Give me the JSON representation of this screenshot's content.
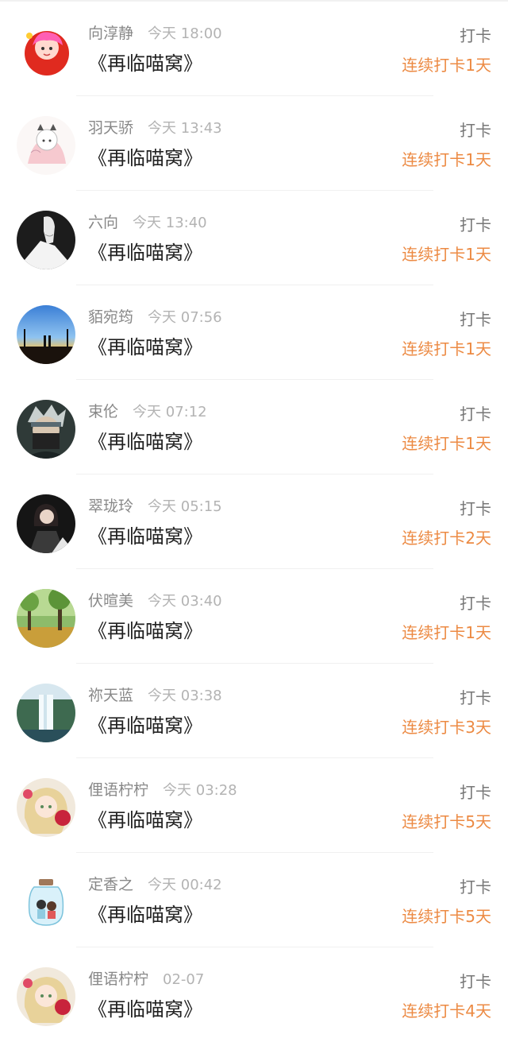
{
  "action_label": "打卡",
  "book_title": "《再临喵窝》",
  "accent_color": "#ec8a43",
  "entries": [
    {
      "name": "向淳静",
      "time": "今天 18:00",
      "streak": "连续打卡1天",
      "avatar": "cartoon-girl-avatar-icon"
    },
    {
      "name": "羽天骄",
      "time": "今天 13:43",
      "streak": "连续打卡1天",
      "avatar": "sketch-girl-avatar-icon"
    },
    {
      "name": "六向",
      "time": "今天 13:40",
      "streak": "连续打卡1天",
      "avatar": "hand-silhouette-avatar-icon"
    },
    {
      "name": "貊宛筠",
      "time": "今天 07:56",
      "streak": "连续打卡1天",
      "avatar": "sunset-couple-avatar-icon"
    },
    {
      "name": "束伦",
      "time": "今天 07:12",
      "streak": "连续打卡1天",
      "avatar": "masked-ninja-avatar-icon"
    },
    {
      "name": "翠珑玲",
      "time": "今天 05:15",
      "streak": "连续打卡2天",
      "avatar": "dark-warrior-avatar-icon"
    },
    {
      "name": "伏暄美",
      "time": "今天 03:40",
      "streak": "连续打卡1天",
      "avatar": "forest-park-avatar-icon"
    },
    {
      "name": "祢天蓝",
      "time": "今天 03:38",
      "streak": "连续打卡3天",
      "avatar": "waterfall-avatar-icon"
    },
    {
      "name": "俚语柠柠",
      "time": "今天 03:28",
      "streak": "连续打卡5天",
      "avatar": "anime-girl-avatar-icon"
    },
    {
      "name": "定香之",
      "time": "今天 00:42",
      "streak": "连续打卡5天",
      "avatar": "jar-couple-avatar-icon"
    },
    {
      "name": "俚语柠柠",
      "time": "02-07",
      "streak": "连续打卡4天",
      "avatar": "anime-girl-avatar-icon"
    }
  ]
}
